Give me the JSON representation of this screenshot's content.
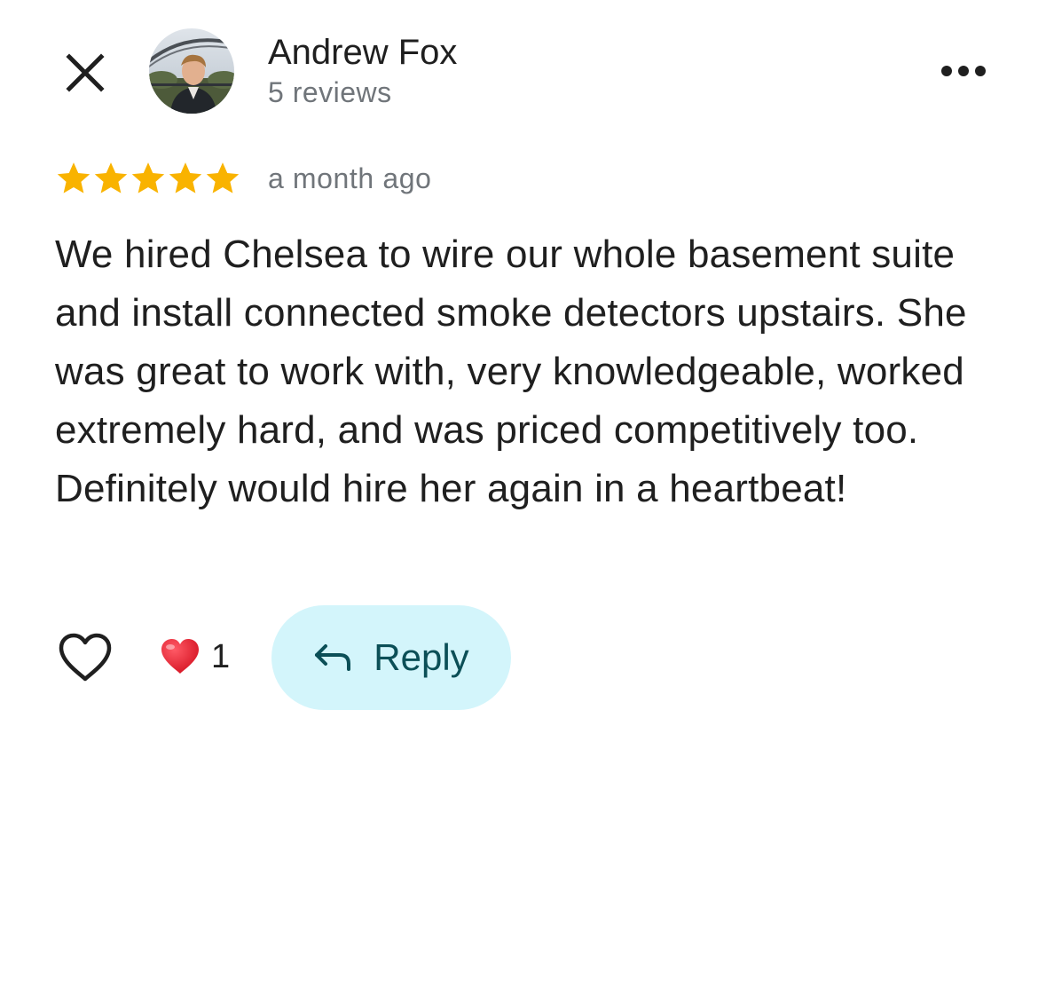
{
  "review": {
    "author": {
      "name": "Andrew Fox",
      "reviews_count": "5 reviews",
      "avatar_icon": "profile-photo"
    },
    "rating": 5,
    "rating_max": 5,
    "time_ago": "a month ago",
    "text": "We hired Chelsea to wire our whole basement suite and install connected smoke detectors upstairs. She was great to work with, very knowledgeable, worked extremely hard, and was priced competitively too. Definitely would hire her again in a heartbeat!",
    "reactions": {
      "icon": "red-heart-icon",
      "count": "1"
    }
  },
  "actions": {
    "close_icon": "close-icon",
    "more_icon": "more-options-icon",
    "like_icon": "heart-outline-icon",
    "reply_icon": "reply-arrow-icon",
    "reply_label": "Reply"
  },
  "colors": {
    "star": "#f9b300",
    "reply_bg": "#d3f5fb",
    "reply_text": "#0b4f57",
    "secondary_text": "#70757a",
    "reaction_heart": "#e3182f"
  }
}
